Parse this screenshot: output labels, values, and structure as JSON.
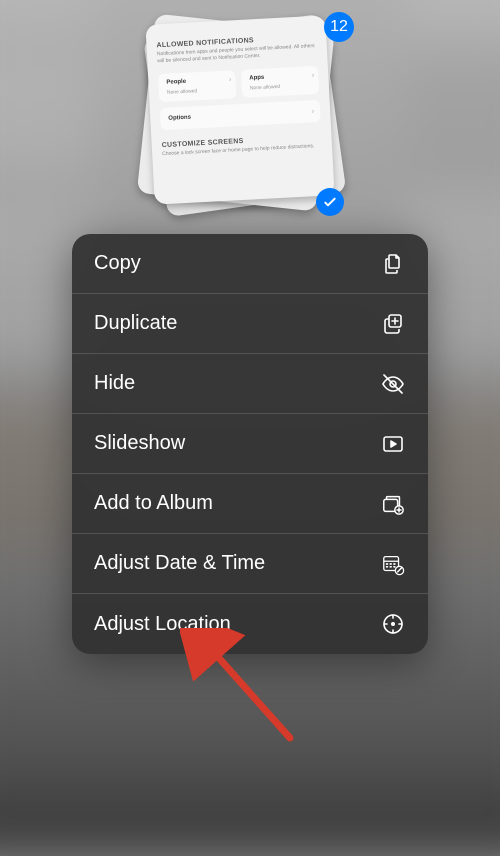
{
  "selection": {
    "count": "12",
    "preview": {
      "header": "ALLOWED NOTIFICATIONS",
      "subtext": "Notifications from apps and people you select will be allowed. All others will be silenced and sent to Notification Center.",
      "people_label": "People",
      "people_sub": "None allowed",
      "apps_label": "Apps",
      "apps_sub": "None allowed",
      "options_label": "Options",
      "customize_header": "CUSTOMIZE SCREENS",
      "customize_sub": "Choose a lock screen face or home page to help reduce distractions."
    }
  },
  "menu": {
    "items": [
      {
        "label": "Copy"
      },
      {
        "label": "Duplicate"
      },
      {
        "label": "Hide"
      },
      {
        "label": "Slideshow"
      },
      {
        "label": "Add to Album"
      },
      {
        "label": "Adjust Date & Time"
      },
      {
        "label": "Adjust Location"
      }
    ]
  },
  "colors": {
    "accent": "#007aff",
    "menu_bg": "rgba(48,48,50,0.93)",
    "arrow": "#d63a2a"
  }
}
